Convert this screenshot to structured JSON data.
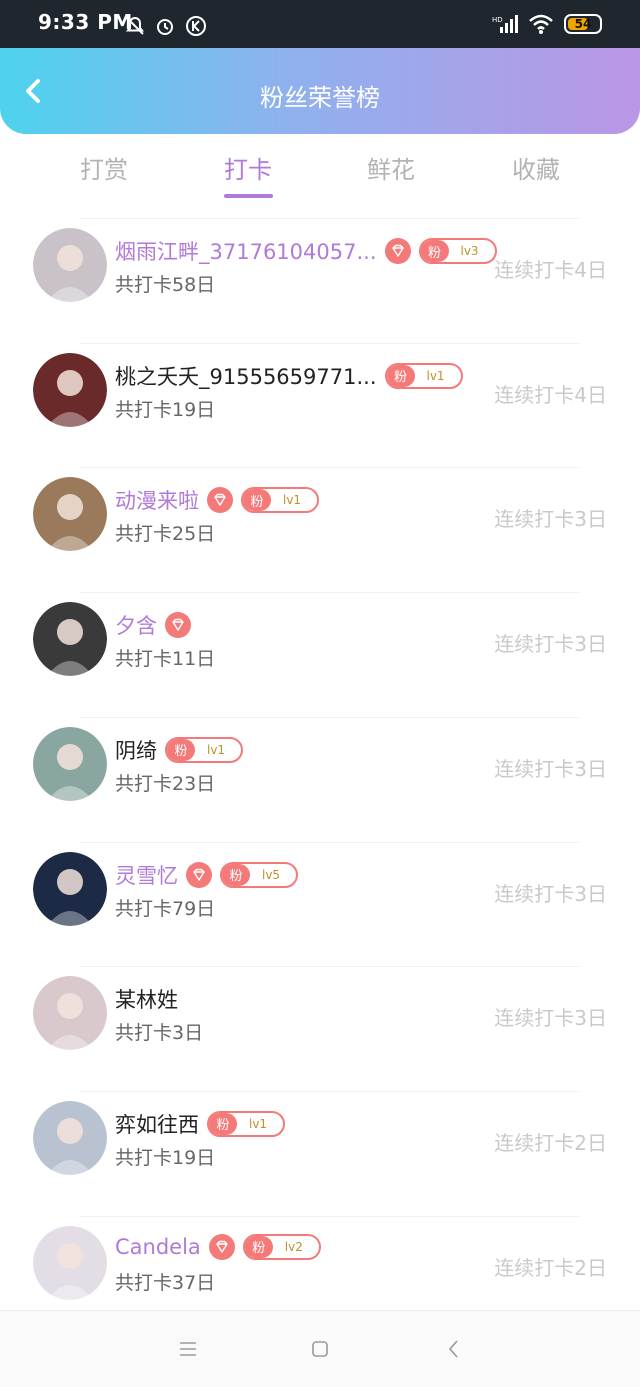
{
  "status_bar": {
    "time": "9:33 PM",
    "battery": "54"
  },
  "header": {
    "title": "粉丝荣誉榜"
  },
  "tabs": [
    {
      "label": "打赏",
      "active": false
    },
    {
      "label": "打卡",
      "active": true
    },
    {
      "label": "鲜花",
      "active": false
    },
    {
      "label": "收藏",
      "active": false
    }
  ],
  "rows": [
    {
      "name": "烟雨江畔_37176104057...",
      "vip": true,
      "diamond": true,
      "fan_badge": "粉",
      "level": "lv3",
      "total": "共打卡58日",
      "streak": "连续打卡4日",
      "avatar_color": "#c9c2c8"
    },
    {
      "name": "桃之夭夭_91555659771...",
      "vip": false,
      "diamond": false,
      "fan_badge": "粉",
      "level": "lv1",
      "total": "共打卡19日",
      "streak": "连续打卡4日",
      "avatar_color": "#6b2a2a"
    },
    {
      "name": "动漫来啦",
      "vip": true,
      "diamond": true,
      "fan_badge": "粉",
      "level": "lv1",
      "total": "共打卡25日",
      "streak": "连续打卡3日",
      "avatar_color": "#9a7a5a"
    },
    {
      "name": "夕含",
      "vip": true,
      "diamond": true,
      "fan_badge": "",
      "level": "",
      "total": "共打卡11日",
      "streak": "连续打卡3日",
      "avatar_color": "#3a3a3a"
    },
    {
      "name": "阴绮",
      "vip": false,
      "diamond": false,
      "fan_badge": "粉",
      "level": "lv1",
      "total": "共打卡23日",
      "streak": "连续打卡3日",
      "avatar_color": "#8aa6a0"
    },
    {
      "name": "灵雪忆",
      "vip": true,
      "diamond": true,
      "fan_badge": "粉",
      "level": "lv5",
      "total": "共打卡79日",
      "streak": "连续打卡3日",
      "avatar_color": "#1c2a45"
    },
    {
      "name": "某林姓",
      "vip": false,
      "diamond": false,
      "fan_badge": "",
      "level": "",
      "total": "共打卡3日",
      "streak": "连续打卡3日",
      "avatar_color": "#d9c8cc"
    },
    {
      "name": "弈如往西",
      "vip": false,
      "diamond": false,
      "fan_badge": "粉",
      "level": "lv1",
      "total": "共打卡19日",
      "streak": "连续打卡2日",
      "avatar_color": "#b8c2d0"
    },
    {
      "name": "Candela",
      "vip": true,
      "diamond": true,
      "fan_badge": "粉",
      "level": "lv2",
      "total": "共打卡37日",
      "streak": "连续打卡2日",
      "avatar_color": "#e3dde6"
    }
  ],
  "colors": {
    "accent": "#b07ad8",
    "badge": "#f47a7a",
    "streak": "#c9c9c9"
  }
}
